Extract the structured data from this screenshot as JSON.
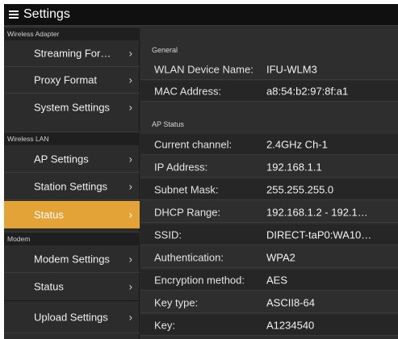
{
  "window": {
    "title": "Settings"
  },
  "sidebar": {
    "sections": [
      {
        "label": "Wireless Adapter"
      },
      {
        "label": "Wireless LAN"
      },
      {
        "label": "Modem"
      }
    ],
    "items": [
      {
        "label": "Streaming For…"
      },
      {
        "label": "Proxy Format"
      },
      {
        "label": "System Settings"
      },
      {
        "label": "AP Settings"
      },
      {
        "label": "Station Settings"
      },
      {
        "label": "Status"
      },
      {
        "label": "Modem Settings"
      },
      {
        "label": "Status"
      },
      {
        "label": "Upload Settings"
      }
    ],
    "chevron": "›",
    "accent": "#e3a336"
  },
  "main": {
    "general": {
      "header": "General",
      "rows": [
        {
          "key": "WLAN Device Name:",
          "value": "IFU-WLM3"
        },
        {
          "key": "MAC Address:",
          "value": "a8:54:b2:97:8f:a1"
        }
      ]
    },
    "ap_status": {
      "header": "AP Status",
      "rows": [
        {
          "key": "Current channel:",
          "value": "2.4GHz Ch-1"
        },
        {
          "key": "IP Address:",
          "value": "192.168.1.1"
        },
        {
          "key": "Subnet Mask:",
          "value": "255.255.255.0"
        },
        {
          "key": "DHCP Range:",
          "value": "192.168.1.2 - 192.1…"
        },
        {
          "key": "SSID:",
          "value": "DIRECT-taP0:WA10…"
        },
        {
          "key": "Authentication:",
          "value": "WPA2"
        },
        {
          "key": "Encryption method:",
          "value": "AES"
        },
        {
          "key": "Key type:",
          "value": "ASCII8-64"
        },
        {
          "key": "Key:",
          "value": "A1234540"
        }
      ]
    }
  }
}
